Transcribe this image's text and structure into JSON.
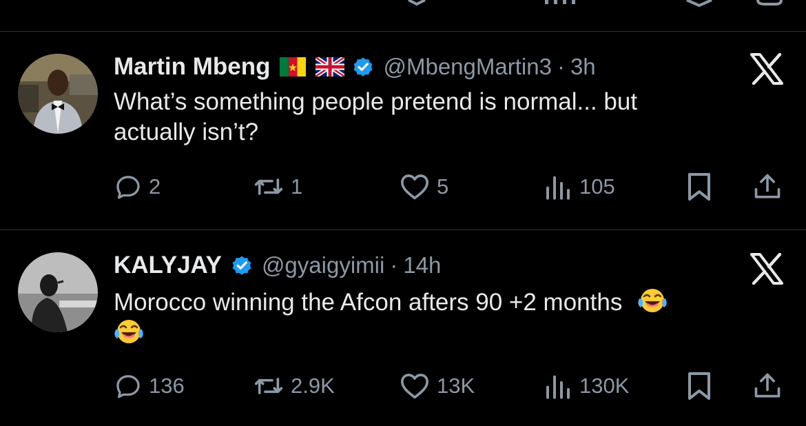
{
  "tweets": [
    {
      "name": "Martin Mbeng",
      "handle": "@MbengMartin3",
      "separator": "·",
      "time": "3h",
      "text_line1": "What’s something people pretend is normal... but",
      "text_line2": "actually isn’t?",
      "flags": [
        "cameroon-flag",
        "uk-flag"
      ],
      "replies": "2",
      "reposts": "1",
      "likes": "5",
      "views": "105"
    },
    {
      "name": "KALYJAY",
      "handle": "@gyaigyimii",
      "separator": "·",
      "time": "14h",
      "text_line1": "Morocco winning the Afcon afters 90 +2 months",
      "text_line2": "",
      "emoji": "laughing-tears-emoji",
      "replies": "136",
      "reposts": "2.9K",
      "likes": "13K",
      "views": "130K"
    }
  ],
  "colors": {
    "background": "#000000",
    "text": "#e7e9ea",
    "muted": "#8b98a5",
    "verified": "#1d9bf0",
    "divider": "#2f3336"
  }
}
